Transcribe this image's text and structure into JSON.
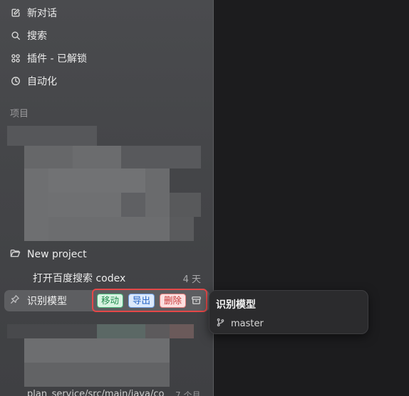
{
  "nav": {
    "new_chat": "新对话",
    "search": "搜索",
    "plugins": "插件 - 已解锁",
    "automation": "自动化"
  },
  "projects": {
    "section_label": "项目",
    "new_project": "New project",
    "thread_1_title": "打开百度搜索 codex",
    "thread_1_time": "4 天",
    "active_title": "识别模型",
    "actions": {
      "move": "移动",
      "export": "导出",
      "delete": "删除"
    }
  },
  "tooltip": {
    "title": "识别模型",
    "branch": "master"
  },
  "colors": {
    "highlight_border": "#e54848",
    "move": "#1f8a4c",
    "export": "#2462c4",
    "delete": "#c83737"
  }
}
